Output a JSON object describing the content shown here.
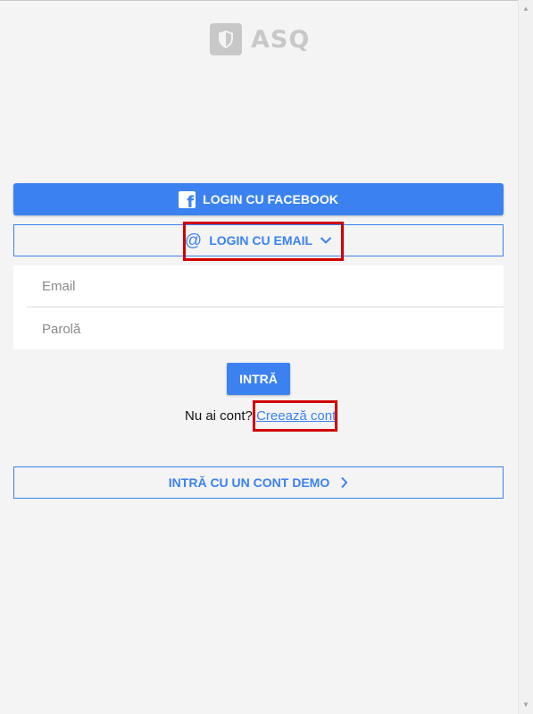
{
  "app": {
    "logo_text": "ASQ"
  },
  "auth": {
    "facebook_button_label": "LOGIN CU FACEBOOK",
    "email_button_label": "LOGIN CU EMAIL",
    "email_placeholder": "Email",
    "password_placeholder": "Parolă",
    "email_value": "",
    "password_value": "",
    "submit_label": "INTRĂ",
    "signup_prompt": "Nu ai cont?",
    "signup_link_label": "Creează cont",
    "demo_button_label": "INTRĂ CU UN CONT DEMO"
  },
  "icons": {
    "logo": "shield-icon",
    "facebook": "facebook-icon",
    "email": "at-sign-icon",
    "email_expand": "chevron-down-icon",
    "demo_arrow": "chevron-right-icon"
  },
  "colors": {
    "accent": "#3b82f0",
    "background": "#f4f4f4",
    "logo": "#c8c8c8",
    "highlight": "#d10000"
  }
}
